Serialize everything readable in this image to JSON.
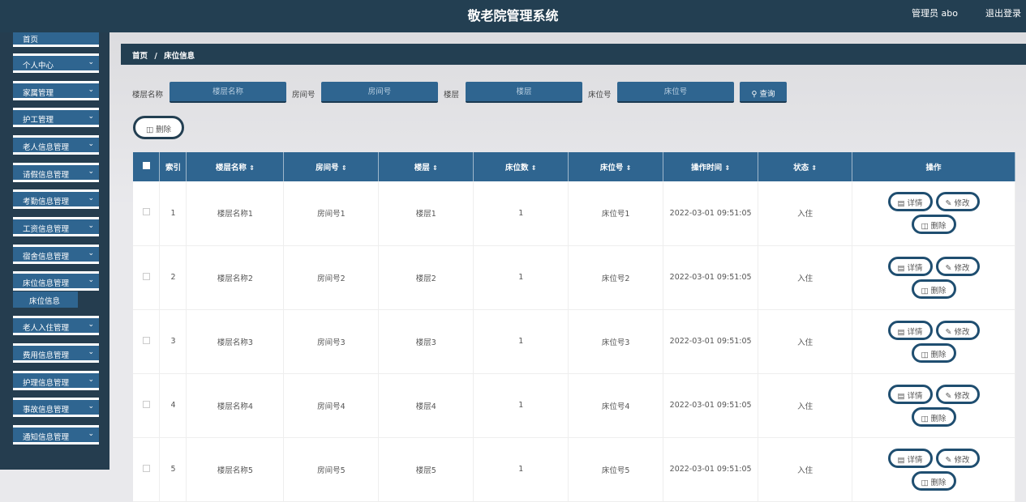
{
  "header": {
    "title": "敬老院管理系统",
    "user": "管理员 abo",
    "logout": "退出登录"
  },
  "sidebar": {
    "items": [
      "首页",
      "个人中心",
      "家属管理",
      "护工管理",
      "老人信息管理",
      "请假信息管理",
      "考勤信息管理",
      "工资信息管理",
      "宿舍信息管理",
      "床位信息管理",
      "老人入住管理",
      "费用信息管理",
      "护理信息管理",
      "事故信息管理",
      "通知信息管理"
    ],
    "submenu": "床位信息"
  },
  "breadcrumb": {
    "home": "首页",
    "sep": "/",
    "current": "床位信息"
  },
  "search": {
    "fields": [
      {
        "label": "楼层名称",
        "placeholder": "楼层名称"
      },
      {
        "label": "房间号",
        "placeholder": "房间号"
      },
      {
        "label": "楼层",
        "placeholder": "楼层"
      },
      {
        "label": "床位号",
        "placeholder": "床位号"
      }
    ],
    "query": "查询"
  },
  "delete_label": "删除",
  "table": {
    "headers": [
      "索引",
      "楼层名称",
      "房间号",
      "楼层",
      "床位数",
      "床位号",
      "操作时间",
      "状态",
      "操作"
    ],
    "rows": [
      [
        "1",
        "楼层名称1",
        "房间号1",
        "楼层1",
        "1",
        "床位号1",
        "2022-03-01 09:51:05",
        "入住"
      ],
      [
        "2",
        "楼层名称2",
        "房间号2",
        "楼层2",
        "1",
        "床位号2",
        "2022-03-01 09:51:05",
        "入住"
      ],
      [
        "3",
        "楼层名称3",
        "房间号3",
        "楼层3",
        "1",
        "床位号3",
        "2022-03-01 09:51:05",
        "入住"
      ],
      [
        "4",
        "楼层名称4",
        "房间号4",
        "楼层4",
        "1",
        "床位号4",
        "2022-03-01 09:51:05",
        "入住"
      ],
      [
        "5",
        "楼层名称5",
        "房间号5",
        "楼层5",
        "1",
        "床位号5",
        "2022-03-01 09:51:05",
        "入住"
      ]
    ],
    "actions": {
      "detail": "详情",
      "edit": "修改",
      "delete": "删除"
    }
  }
}
